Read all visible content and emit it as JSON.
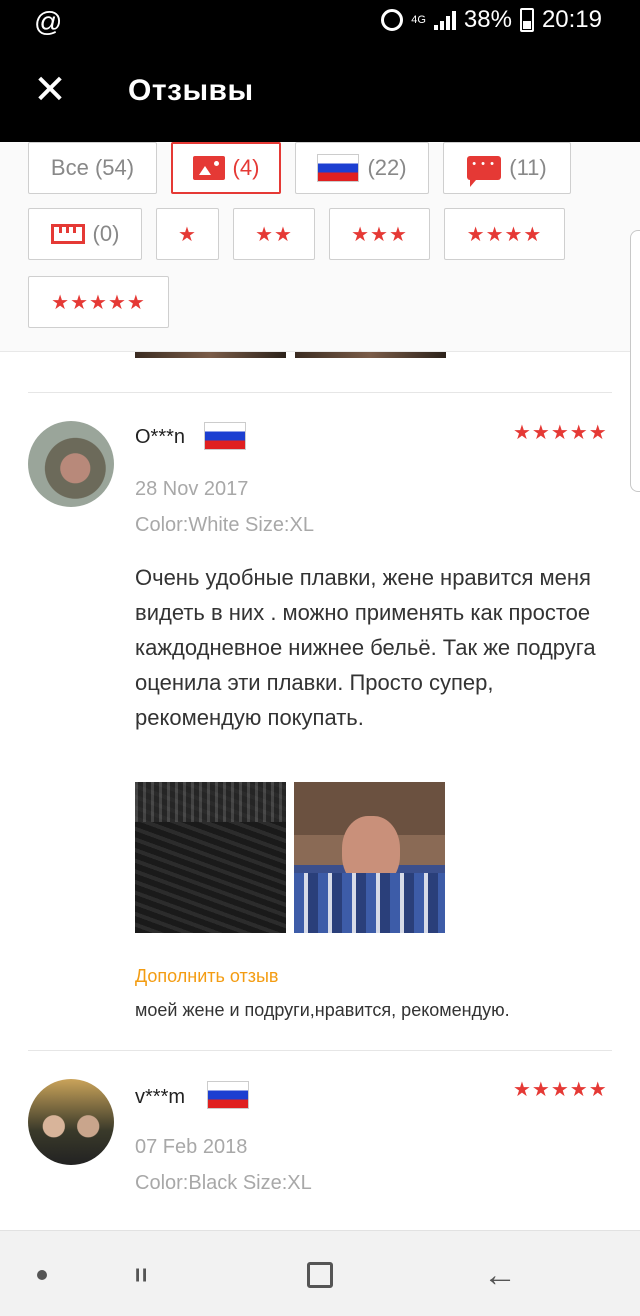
{
  "status_bar": {
    "left_icon": "@",
    "network": "4G",
    "battery": "38%",
    "time": "20:19"
  },
  "app_bar": {
    "close_icon": "✕",
    "title": "Отзывы"
  },
  "filters": {
    "all": "Все (54)",
    "photos": "(4)",
    "country": "(22)",
    "comments": "(11)",
    "size": "(0)",
    "stars_1": "★",
    "stars_2": "★★",
    "stars_3": "★★★",
    "stars_4": "★★★★",
    "stars_5": "★★★★★",
    "active": "photos"
  },
  "reviews": [
    {
      "user": "O***n",
      "country": "Russia",
      "rating_stars": "★★★★★",
      "date": "28 Nov 2017",
      "sku": "Color:White Size:XL",
      "text": "Очень удобные плавки, жене нравится меня видеть в них . можно применять как простое каждодневное нижнее бельё. Так же подруга оценила эти плавки. Просто супер, рекомендую покупать.",
      "photos": 2,
      "additional_label": "Дополнить отзыв",
      "additional_text": "моей жене и подруги,нравится, рекомендую."
    },
    {
      "user": "v***m",
      "country": "Russia",
      "rating_stars": "★★★★★",
      "date": "07 Feb 2018",
      "sku": "Color:Black Size:XL"
    }
  ],
  "colors": {
    "accent": "#e53935",
    "addon": "#f39c12",
    "muted": "#a8a8a8"
  },
  "nav_bar": {
    "back_icon": "←"
  }
}
